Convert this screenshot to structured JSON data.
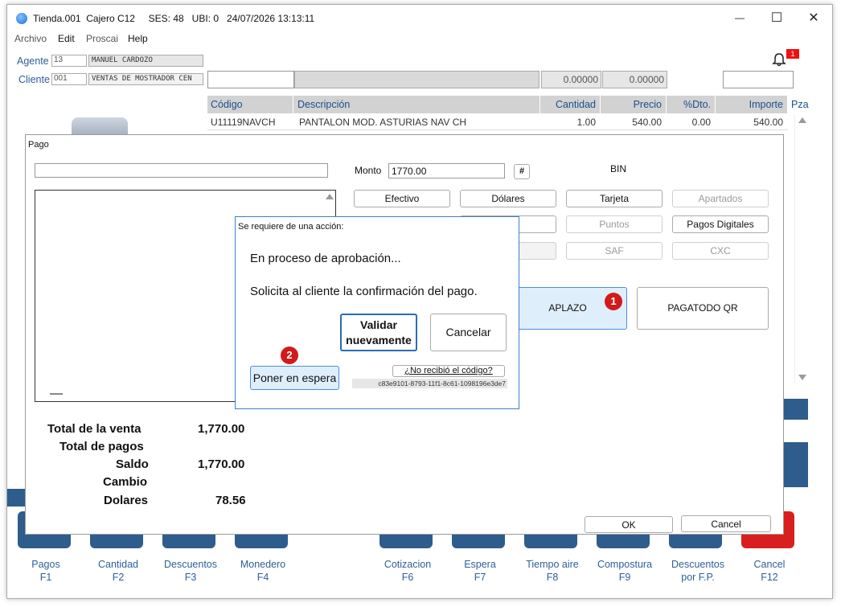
{
  "window": {
    "title": "Tienda.001  Cajero C12     SES: 48   UBI: 0   24/07/2026 13:13:11",
    "minimize": "—",
    "maximize": "☐",
    "close": "✕"
  },
  "menu": [
    "Archivo",
    "Edit",
    "Proscai",
    "Help"
  ],
  "notifications": {
    "count": "1"
  },
  "header": {
    "agente_label": "Agente",
    "agente_code": "13",
    "agente_name": "MANUEL CARDOZO",
    "cliente_label": "Cliente",
    "cliente_code": "001",
    "cliente_name": "VENTAS DE MOSTRADOR CEN",
    "qty_field": "0.00000",
    "price_field": "0.00000"
  },
  "table": {
    "columns": [
      "Código",
      "Descripción",
      "Cantidad",
      "Precio",
      "%Dto.",
      "Importe",
      "Pza"
    ],
    "rows": [
      {
        "codigo": "U11119NAVCH",
        "descripcion": "PANTALON MOD. ASTURIAS NAV CH",
        "cantidad": "1.00",
        "precio": "540.00",
        "dto": "0.00",
        "importe": "540.00"
      }
    ]
  },
  "pago": {
    "title": "Pago",
    "monto_label": "Monto",
    "monto_value": "1770.00",
    "hash_btn": "#",
    "bin_label": "BIN",
    "methods": [
      {
        "label": "Efectivo",
        "enabled": true
      },
      {
        "label": "Dólares",
        "enabled": true
      },
      {
        "label": "Tarjeta",
        "enabled": true
      },
      {
        "label": "Apartados",
        "enabled": false
      },
      {
        "label": "Puntos",
        "enabled": false
      },
      {
        "label": "Pagos Digitales",
        "enabled": true
      },
      {
        "label": "SAF",
        "enabled": false
      },
      {
        "label": "CXC",
        "enabled": false
      }
    ],
    "aplazo": "APLAZO",
    "aplazo_marker": "1",
    "pagatodo": "PAGATODO QR",
    "totals": {
      "venta_label": "Total de la venta",
      "venta_value": "1,770.00",
      "pagos_label": "Total de pagos",
      "saldo_label": "Saldo",
      "saldo_value": "1,770.00",
      "cambio_label": "Cambio",
      "dolares_label": "Dolares",
      "dolares_value": "78.56"
    },
    "ok": "OK",
    "cancel": "Cancel"
  },
  "dialog": {
    "title": "Se requiere de una acción:",
    "line1": "En proceso de aprobación...",
    "line2": "Solicita al cliente la confirmación del pago.",
    "validar": "Validar nuevamente",
    "cancelar": "Cancelar",
    "marker": "2",
    "poner": "Poner en espera",
    "no_recibio": "¿No recibió el código?",
    "uuid": "c83e9101-8793-11f1-8c61-1098196e3de7"
  },
  "function_keys": [
    {
      "label": "Pagos",
      "key": "F1"
    },
    {
      "label": "Cantidad",
      "key": "F2"
    },
    {
      "label": "Descuentos",
      "key": "F3"
    },
    {
      "label": "Monedero",
      "key": "F4"
    },
    {
      "label": "Cotizacion",
      "key": "F6"
    },
    {
      "label": "Espera",
      "key": "F7"
    },
    {
      "label": "Tiempo aire",
      "key": "F8"
    },
    {
      "label": "Compostura",
      "key": "F9"
    },
    {
      "label": "Descuentos por F.P.",
      "key": ""
    },
    {
      "label": "Cancel",
      "key": "F12"
    }
  ],
  "colors": {
    "accent": "#2e5c8d",
    "dialog_border": "#3c7fc8",
    "marker": "#d11a1a",
    "cancel_key": "#d81e1e"
  }
}
